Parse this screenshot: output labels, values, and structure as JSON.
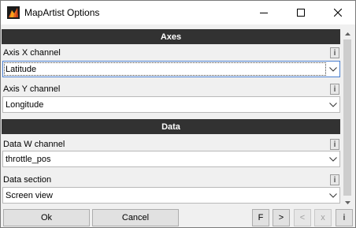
{
  "window": {
    "title": "MapArtist Options"
  },
  "sections": [
    {
      "header": "Axes",
      "fields": [
        {
          "label": "Axis X channel",
          "value": "Latitude",
          "info": "i"
        },
        {
          "label": "Axis Y channel",
          "value": "Longitude",
          "info": "i"
        }
      ]
    },
    {
      "header": "Data",
      "fields": [
        {
          "label": "Data W channel",
          "value": "throttle_pos",
          "info": "i"
        },
        {
          "label": "Data section",
          "value": "Screen view",
          "info": "i"
        }
      ]
    }
  ],
  "buttons": {
    "ok": "Ok",
    "cancel": "Cancel",
    "f": "F",
    "next": ">",
    "prev": "<",
    "x": "x",
    "info": "i"
  },
  "colors": {
    "section_header_bg": "#323232",
    "focus_border": "#4a7fd0"
  },
  "icons": {
    "app": "mapartist-app-icon",
    "minimize": "minimize-icon",
    "maximize": "maximize-icon",
    "close": "close-icon",
    "dropdown": "chevron-down-icon"
  }
}
